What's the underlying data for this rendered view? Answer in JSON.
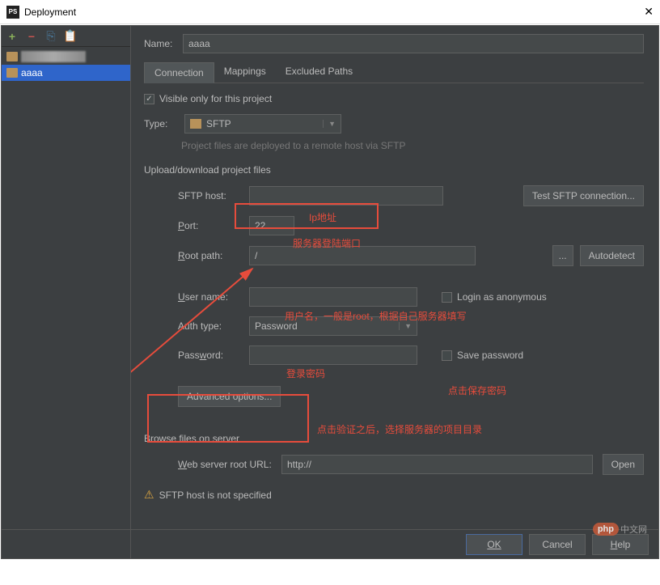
{
  "window": {
    "title": "Deployment"
  },
  "sidebar": {
    "items": [
      {
        "label": ""
      },
      {
        "label": "aaaa"
      }
    ]
  },
  "form": {
    "name_label": "Name:",
    "name_value": "aaaa",
    "tabs": [
      "Connection",
      "Mappings",
      "Excluded Paths"
    ],
    "visible_only": "Visible only for this project",
    "type_label": "Type:",
    "type_value": "SFTP",
    "type_hint": "Project files are deployed to a remote host via SFTP",
    "upload_section": "Upload/download project files",
    "sftp_host_label": "SFTP host:",
    "test_btn": "Test SFTP connection...",
    "port_label": "Port:",
    "port_value": "22",
    "root_label": "Root path:",
    "root_value": "/",
    "browse_btn": "...",
    "autodetect_btn": "Autodetect",
    "user_label": "User name:",
    "login_anon": "Login as anonymous",
    "auth_label": "Auth type:",
    "auth_value": "Password",
    "password_label": "Password:",
    "save_pw": "Save password",
    "advanced_btn": "Advanced options...",
    "browse_section": "Browse files on server",
    "web_url_label": "Web server root URL:",
    "web_url_value": "http://",
    "open_btn": "Open",
    "warning": "SFTP host is not specified"
  },
  "annotations": {
    "ip": "Ip地址",
    "port": "服务器登陆端口",
    "user": "用户名，一般是root，根据自己服务器填写",
    "pw": "登录密码",
    "savepw": "点击保存密码",
    "advanced": "点击验证之后，选择服务器的项目目录"
  },
  "footer": {
    "ok": "OK",
    "cancel": "Cancel",
    "help": "Help"
  },
  "watermark": {
    "brand": "php",
    "text": "中文网"
  }
}
